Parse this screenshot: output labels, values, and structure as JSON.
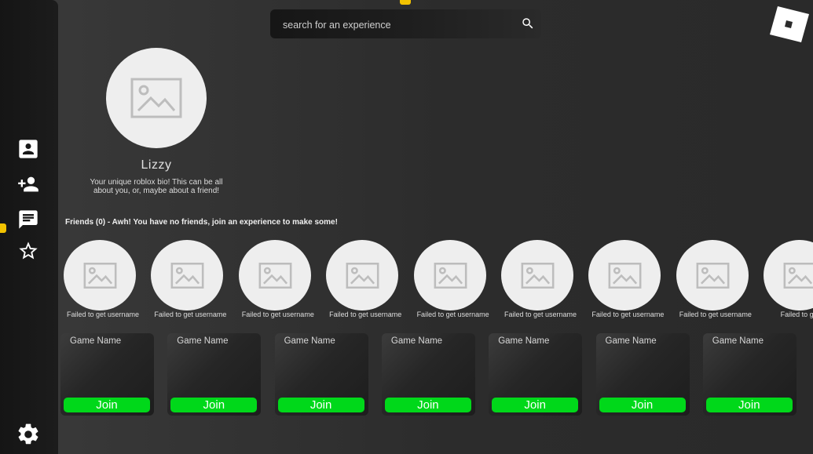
{
  "search": {
    "placeholder": "search for an experience"
  },
  "profile": {
    "username": "Lizzy",
    "bio": "Your unique roblox bio! This can be all about you, or, maybe about a friend!"
  },
  "sidebar": {
    "items": [
      {
        "icon": "contact-card-icon"
      },
      {
        "icon": "add-friend-icon"
      },
      {
        "icon": "chat-icon"
      },
      {
        "icon": "star-icon"
      },
      {
        "icon": "gear-icon"
      }
    ]
  },
  "friends": {
    "title": "Friends (0) - Awh! You have no friends, join an experience to make some!",
    "items": [
      {
        "name": "Failed to get username"
      },
      {
        "name": "Failed to get username"
      },
      {
        "name": "Failed to get username"
      },
      {
        "name": "Failed to get username"
      },
      {
        "name": "Failed to get username"
      },
      {
        "name": "Failed to get username"
      },
      {
        "name": "Failed to get username"
      },
      {
        "name": "Failed to get username"
      },
      {
        "name": "Failed to get u"
      }
    ]
  },
  "games": [
    {
      "name": "Game Name",
      "join_label": "Join"
    },
    {
      "name": "Game Name",
      "join_label": "Join"
    },
    {
      "name": "Game Name",
      "join_label": "Join"
    },
    {
      "name": "Game Name",
      "join_label": "Join"
    },
    {
      "name": "Game Name",
      "join_label": "Join"
    },
    {
      "name": "Game Name",
      "join_label": "Join"
    },
    {
      "name": "Game Name",
      "join_label": "Join"
    }
  ],
  "colors": {
    "join_green": "#00d81a",
    "notice_yellow": "#f2c200",
    "placeholder_bg": "#eeeeee"
  }
}
